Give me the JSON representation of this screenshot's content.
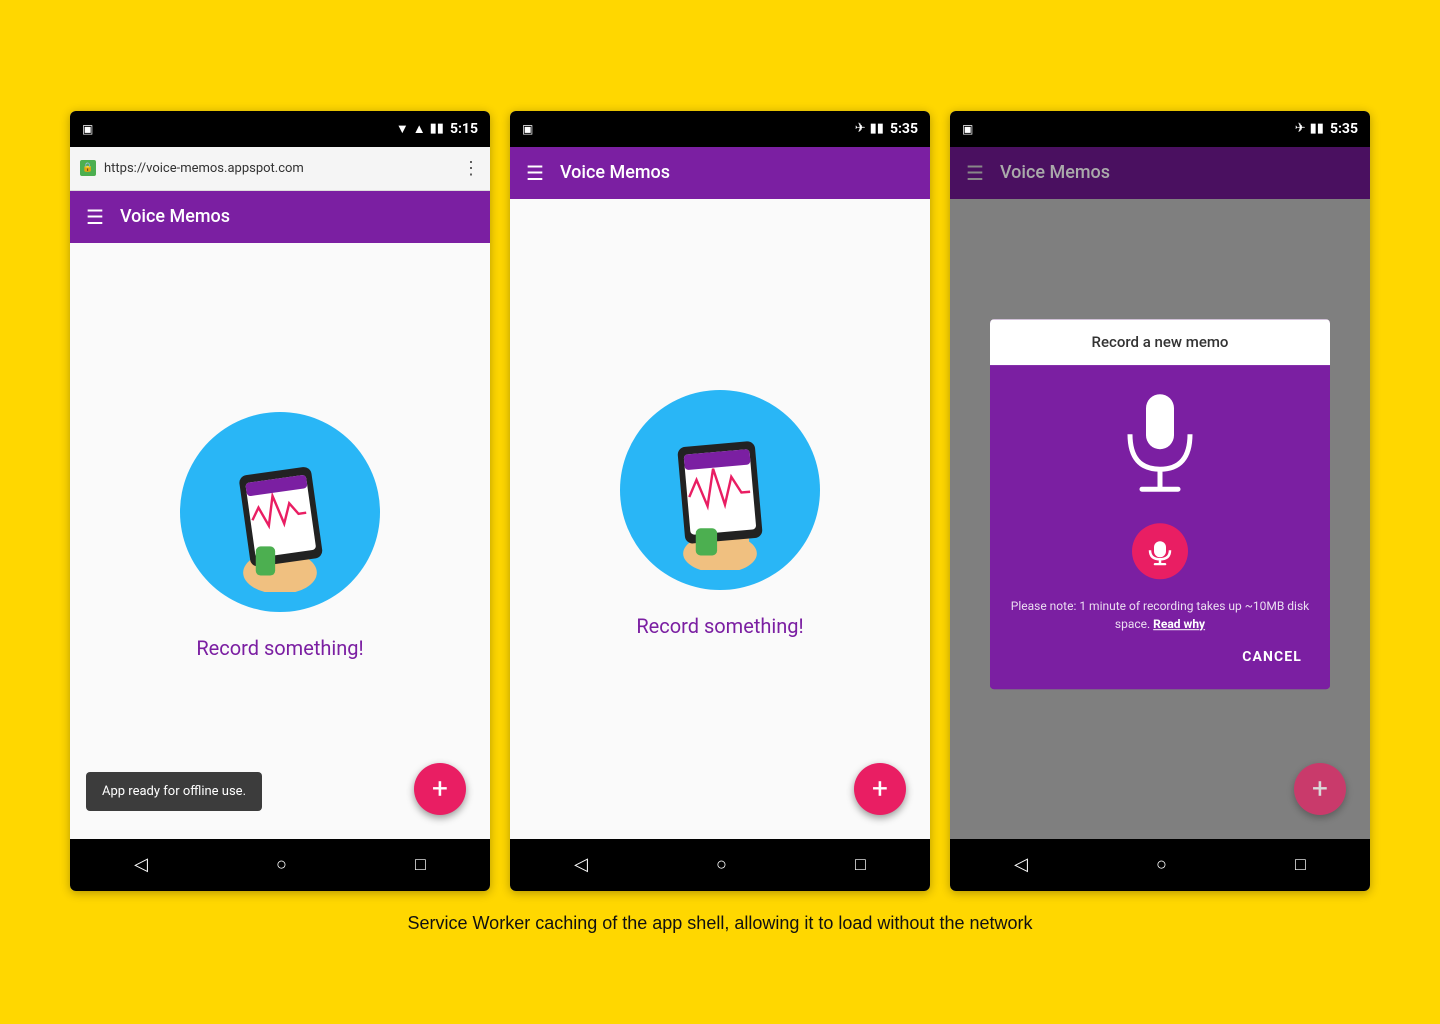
{
  "background_color": "#FFD700",
  "caption": "Service Worker caching of the app shell, allowing it to load without the network",
  "phone1": {
    "status_bar": {
      "time": "5:15",
      "left_icon": "☰",
      "icons": "▼▲▮▮"
    },
    "url_bar": {
      "url": "https://voice-memos.appspot.com",
      "lock_symbol": "🔒",
      "menu_dots": "⋮"
    },
    "app_bar": {
      "hamburger": "☰",
      "title": "Voice Memos"
    },
    "content": {
      "record_label": "Record something!"
    },
    "snackbar": {
      "text": "App ready for offline use."
    },
    "fab": {
      "label": "+"
    },
    "nav_buttons": [
      "◁",
      "○",
      "□"
    ]
  },
  "phone2": {
    "status_bar": {
      "time": "5:35",
      "icons": "✈▮▮"
    },
    "app_bar": {
      "hamburger": "☰",
      "title": "Voice Memos"
    },
    "content": {
      "record_label": "Record something!"
    },
    "fab": {
      "label": "+"
    },
    "nav_buttons": [
      "◁",
      "○",
      "□"
    ]
  },
  "phone3": {
    "status_bar": {
      "time": "5:35",
      "icons": "✈▮▮"
    },
    "app_bar": {
      "hamburger": "☰",
      "title": "Voice Memos"
    },
    "dialog": {
      "title": "Record a new memo",
      "note_text": "Please note: 1 minute of recording takes up ~10MB disk space.",
      "read_why_link": "Read why",
      "cancel_label": "CANCEL"
    },
    "fab": {
      "label": "+"
    },
    "nav_buttons": [
      "◁",
      "○",
      "□"
    ]
  }
}
